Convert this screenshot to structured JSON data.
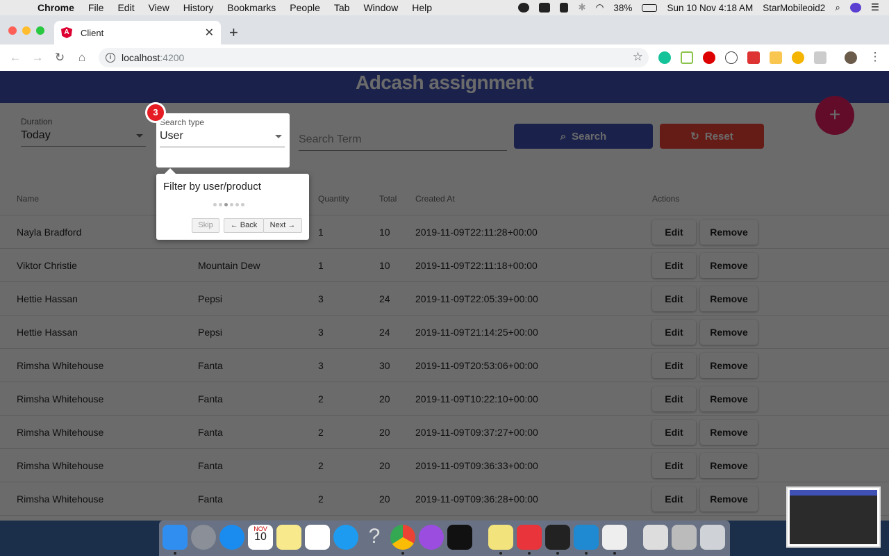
{
  "menubar": {
    "app": "Chrome",
    "items": [
      "File",
      "Edit",
      "View",
      "History",
      "Bookmarks",
      "People",
      "Tab",
      "Window",
      "Help"
    ],
    "battery": "38%",
    "datetime": "Sun 10 Nov  4:18 AM",
    "user": "StarMobileoid2"
  },
  "browser": {
    "tab_title": "Client",
    "url_host": "localhost",
    "url_port": ":4200"
  },
  "app": {
    "title": "Adcash assignment",
    "duration": {
      "label": "Duration",
      "value": "Today"
    },
    "search_type": {
      "label": "Search type",
      "value": "User"
    },
    "search_term_placeholder": "Search Term",
    "search_button": "Search",
    "reset_button": "Reset",
    "fab": "+"
  },
  "table": {
    "headers": [
      "Name",
      "",
      "Quantity",
      "Total",
      "Created At",
      "Actions"
    ],
    "rows": [
      {
        "name": "Nayla Bradford",
        "product": "",
        "quantity": "1",
        "total": "10",
        "created": "2019-11-09T22:11:28+00:00"
      },
      {
        "name": "Viktor Christie",
        "product": "Mountain Dew",
        "quantity": "1",
        "total": "10",
        "created": "2019-11-09T22:11:18+00:00"
      },
      {
        "name": "Hettie Hassan",
        "product": "Pepsi",
        "quantity": "3",
        "total": "24",
        "created": "2019-11-09T22:05:39+00:00"
      },
      {
        "name": "Hettie Hassan",
        "product": "Pepsi",
        "quantity": "3",
        "total": "24",
        "created": "2019-11-09T21:14:25+00:00"
      },
      {
        "name": "Rimsha Whitehouse",
        "product": "Fanta",
        "quantity": "3",
        "total": "30",
        "created": "2019-11-09T20:53:06+00:00"
      },
      {
        "name": "Rimsha Whitehouse",
        "product": "Fanta",
        "quantity": "2",
        "total": "20",
        "created": "2019-11-09T10:22:10+00:00"
      },
      {
        "name": "Rimsha Whitehouse",
        "product": "Fanta",
        "quantity": "2",
        "total": "20",
        "created": "2019-11-09T09:37:27+00:00"
      },
      {
        "name": "Rimsha Whitehouse",
        "product": "Fanta",
        "quantity": "2",
        "total": "20",
        "created": "2019-11-09T09:36:33+00:00"
      },
      {
        "name": "Rimsha Whitehouse",
        "product": "Fanta",
        "quantity": "2",
        "total": "20",
        "created": "2019-11-09T09:36:28+00:00"
      }
    ],
    "edit_label": "Edit",
    "remove_label": "Remove"
  },
  "tour": {
    "step": "3",
    "text": "Filter by user/product",
    "skip": "Skip",
    "back": "← Back",
    "next": "Next →"
  },
  "dock_date": {
    "month": "NOV",
    "day": "10"
  }
}
